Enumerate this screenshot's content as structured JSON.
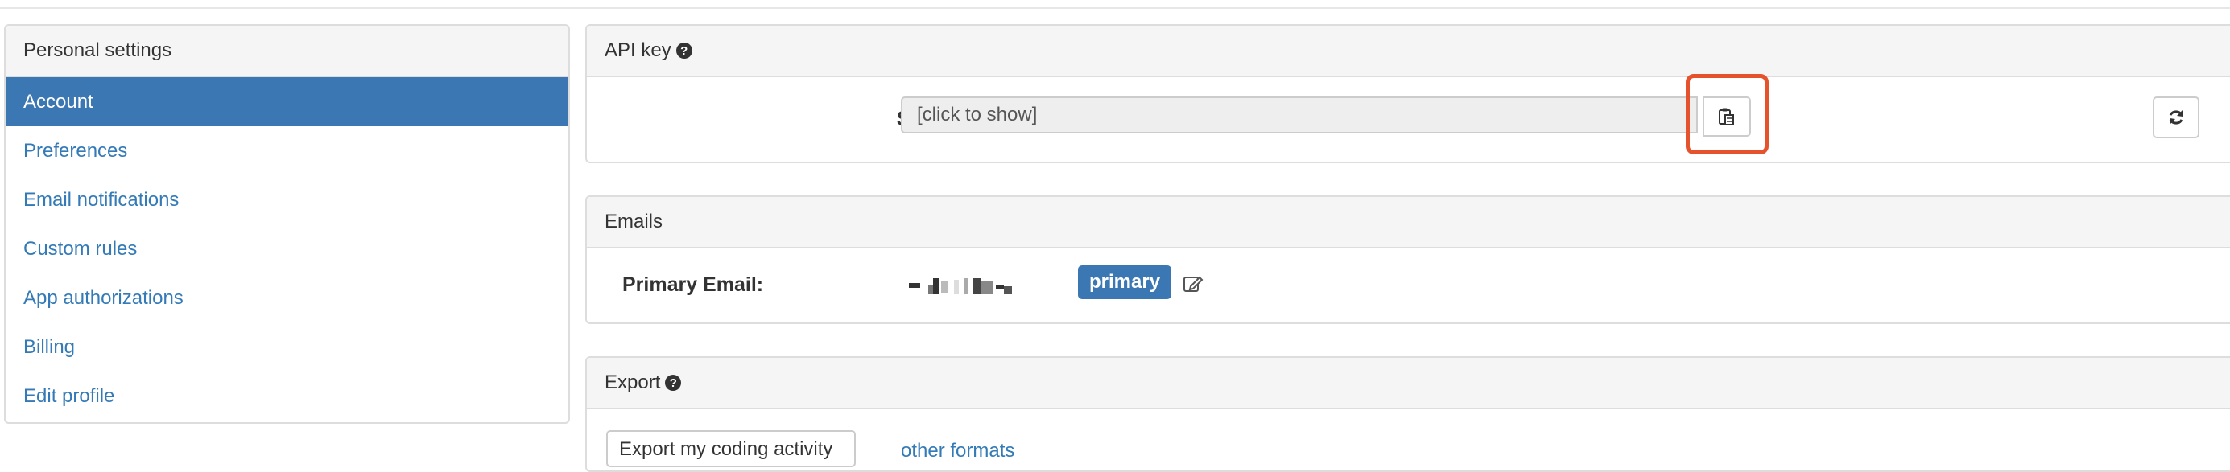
{
  "sidebar": {
    "heading": "Personal settings",
    "items": [
      {
        "label": "Account",
        "active": true
      },
      {
        "label": "Preferences"
      },
      {
        "label": "Email notifications"
      },
      {
        "label": "Custom rules"
      },
      {
        "label": "App authorizations"
      },
      {
        "label": "Billing"
      },
      {
        "label": "Edit profile"
      }
    ]
  },
  "api_panel": {
    "title": "API key",
    "secret_label": "Secret API Key:",
    "secret_value": "[click to show]"
  },
  "emails_panel": {
    "title": "Emails",
    "primary_label": "Primary Email:",
    "primary_badge": "primary"
  },
  "export_panel": {
    "title": "Export",
    "export_button": "Export my coding activity",
    "other_formats_link": "other formats"
  },
  "colors": {
    "accent": "#3b78b3",
    "link": "#337ab7",
    "highlight": "#e5532d"
  }
}
